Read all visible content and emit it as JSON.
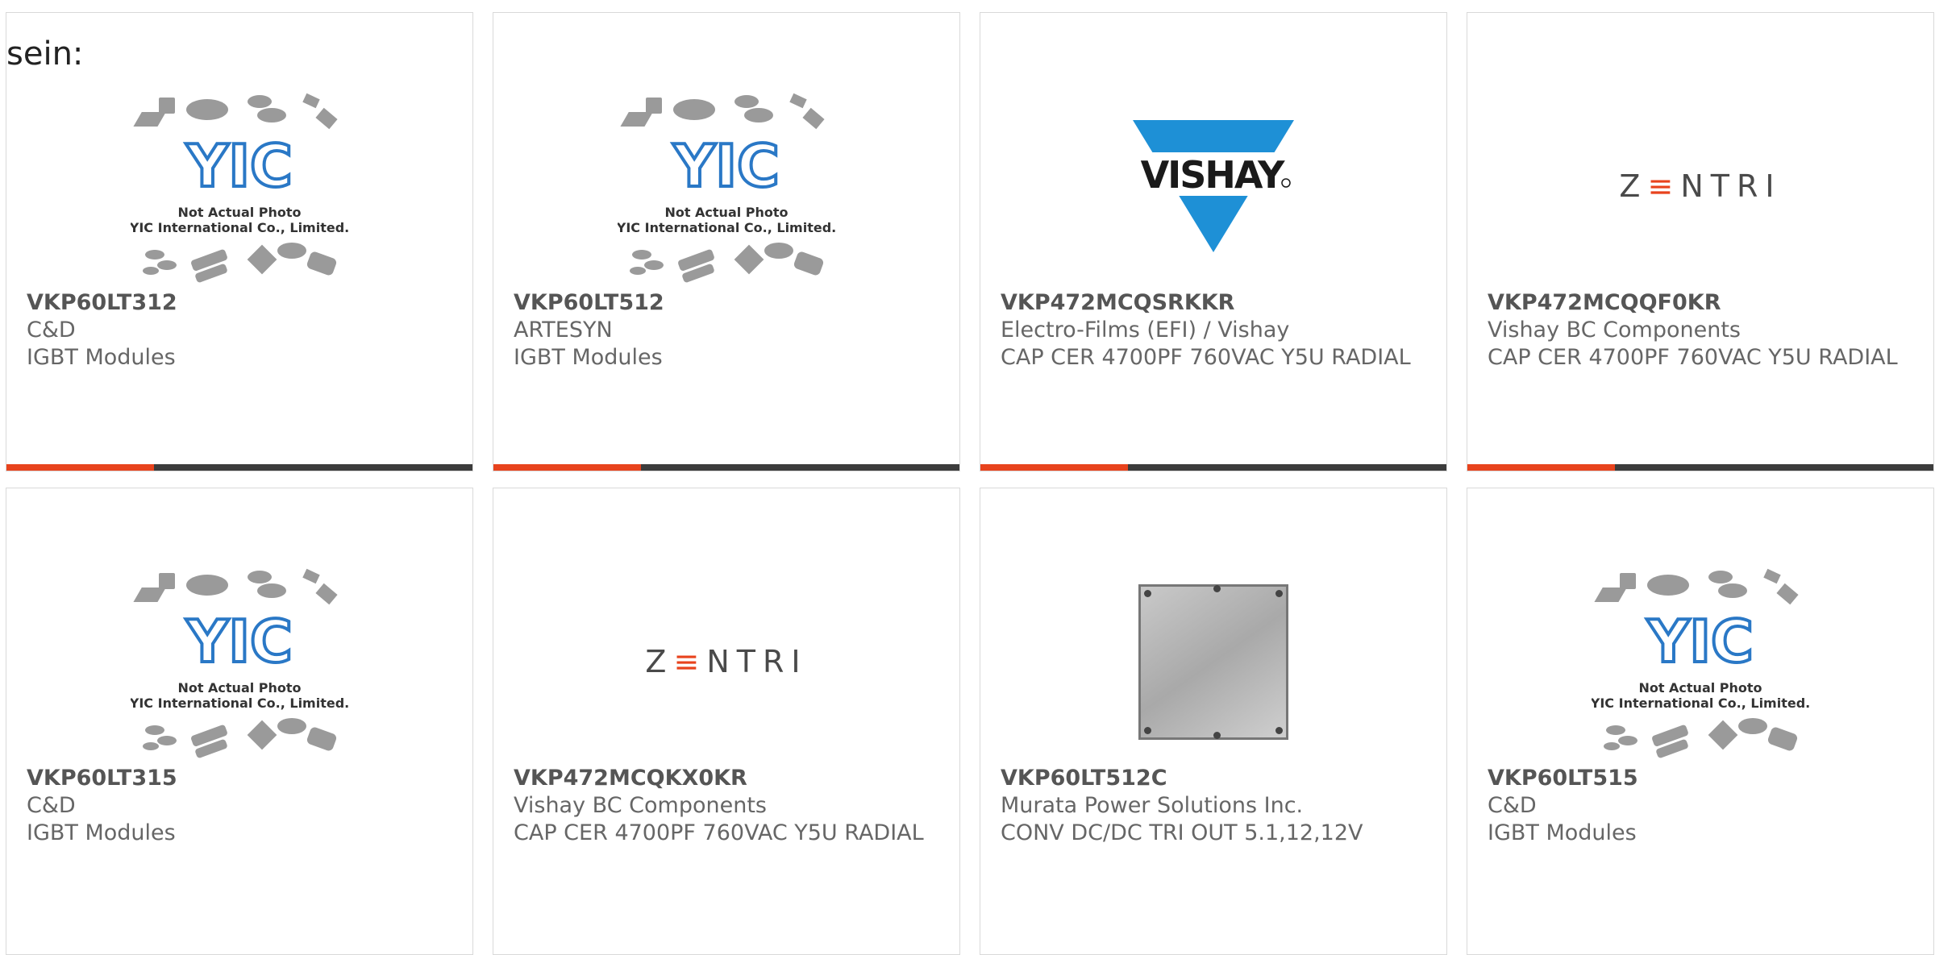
{
  "intro_text": "sein:",
  "colors": {
    "accent": "#e8431d",
    "bar": "#3c3c3c",
    "vishay_blue": "#1e90d6"
  },
  "placeholder": {
    "brand": "YIC",
    "line1": "Not Actual Photo",
    "line2": "YIC International Co., Limited."
  },
  "vishay": {
    "brand": "VISHAY"
  },
  "zentri": {
    "left": "Z",
    "mid": "≡",
    "right": "NTRI"
  },
  "products": [
    {
      "part": "VKP60LT312",
      "manufacturer": "C&D",
      "description": "IGBT Modules",
      "image": "yic-placeholder"
    },
    {
      "part": "VKP60LT512",
      "manufacturer": "ARTESYN",
      "description": "IGBT Modules",
      "image": "yic-placeholder"
    },
    {
      "part": "VKP472MCQSRKKR",
      "manufacturer": "Electro-Films (EFI) / Vishay",
      "description": "CAP CER 4700PF 760VAC Y5U RADIAL",
      "image": "vishay-logo"
    },
    {
      "part": "VKP472MCQQF0KR",
      "manufacturer": "Vishay BC Components",
      "description": "CAP CER 4700PF 760VAC Y5U RADIAL",
      "image": "zentri-logo"
    },
    {
      "part": "VKP60LT315",
      "manufacturer": "C&D",
      "description": "IGBT Modules",
      "image": "yic-placeholder"
    },
    {
      "part": "VKP472MCQKX0KR",
      "manufacturer": "Vishay BC Components",
      "description": "CAP CER 4700PF 760VAC Y5U RADIAL",
      "image": "zentri-logo"
    },
    {
      "part": "VKP60LT512C",
      "manufacturer": "Murata Power Solutions Inc.",
      "description": "CONV DC/DC TRI OUT 5.1,12,12V",
      "image": "module-photo"
    },
    {
      "part": "VKP60LT515",
      "manufacturer": "C&D",
      "description": "IGBT Modules",
      "image": "yic-placeholder"
    }
  ]
}
